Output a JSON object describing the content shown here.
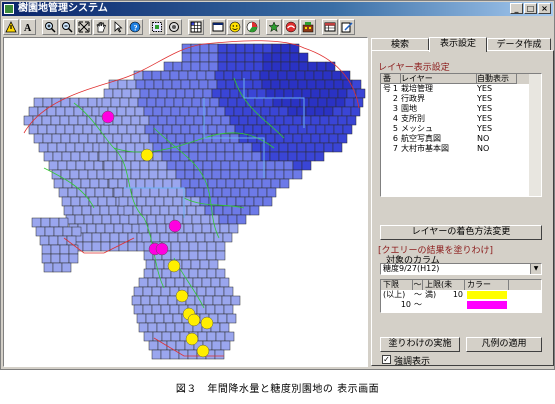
{
  "window": {
    "title": "樹園地管理システム",
    "controls": [
      "_",
      "□",
      "×"
    ]
  },
  "toolbar": {
    "icons": [
      "warning-icon",
      "text-icon",
      "zoom-in-icon",
      "zoom-out-icon",
      "full-extent-icon",
      "pan-hand-icon",
      "select-arrow-icon",
      "identify-icon",
      "locate-icon",
      "grid-icon",
      "select-rect-icon",
      "face-icon",
      "pie-icon",
      "star-icon",
      "map-icon",
      "building-icon",
      "layer-window-icon",
      "edit-icon"
    ]
  },
  "map": {
    "colors": {
      "light": "#9aa6ee",
      "mid": "#6d7ae8",
      "dark": "#3a45d6",
      "darker": "#2a32c4",
      "grid": "#2a2a2a",
      "river": "#32c832",
      "boundary": "#e03030",
      "road": "#6ab0f0"
    },
    "markers": {
      "magenta": "#ff00e0",
      "yellow": "#ffee00"
    }
  },
  "tabs": [
    {
      "label": "検索",
      "active": false
    },
    {
      "label": "表示設定",
      "active": true
    },
    {
      "label": "データ作成",
      "active": false
    }
  ],
  "layers": {
    "group_label": "レイヤー表示設定",
    "headers": [
      "番号",
      "レイヤー",
      "自動表示"
    ],
    "rows": [
      {
        "num": "1",
        "name": "栽培管理",
        "auto": "YES"
      },
      {
        "num": "2",
        "name": "行政界",
        "auto": "YES"
      },
      {
        "num": "3",
        "name": "園地",
        "auto": "YES"
      },
      {
        "num": "4",
        "name": "支所別",
        "auto": "YES"
      },
      {
        "num": "5",
        "name": "メッシュ",
        "auto": "YES"
      },
      {
        "num": "6",
        "name": "航空写真図",
        "auto": "NO"
      },
      {
        "num": "7",
        "name": "大村市基本図",
        "auto": "NO"
      }
    ],
    "color_method_button": "レイヤーの着色方法変更"
  },
  "query": {
    "group_label": "[クエリーの結果を塗りわけ]",
    "column_label": "対象のカラム",
    "column_value": "糖度9/27(H12)",
    "headers": [
      "下限(以上)",
      "～",
      "上限(未満)",
      "カラー"
    ],
    "ranges": [
      {
        "lower": "",
        "sep": "～",
        "upper": "10",
        "color": "#ffff00"
      },
      {
        "lower": "10",
        "sep": "～",
        "upper": "",
        "color": "#ff00ff"
      }
    ],
    "apply_fill_button": "塗りわけの実施",
    "apply_legend_button": "凡例の適用",
    "emphasis_checkbox_label": "強調表示",
    "emphasis_checked": true
  },
  "caption": "図３　年間降水量と糖度別園地の 表示画面"
}
